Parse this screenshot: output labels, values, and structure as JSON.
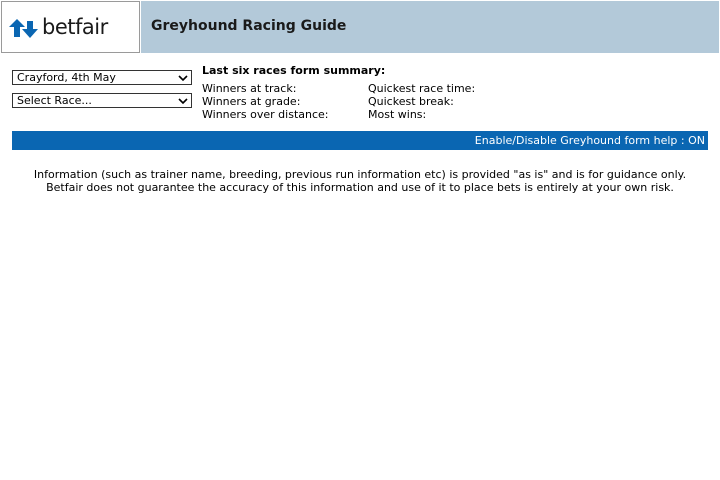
{
  "header": {
    "logo_text": "betfair",
    "title": "Greyhound Racing Guide"
  },
  "selectors": {
    "meeting": "Crayford, 4th May",
    "race": "Select Race..."
  },
  "summary": {
    "title": "Last six races form summary:",
    "left_stats": [
      "Winners at track:",
      "Winners at grade:",
      "Winners over distance:"
    ],
    "right_stats": [
      "Quickest race time:",
      "Quickest break:",
      "Most wins:"
    ]
  },
  "help_toggle": {
    "label": "Enable/Disable Greyhound form help : ON"
  },
  "disclaimer": {
    "line1": "Information (such as trainer name, breeding, previous run information etc) is provided \"as is\" and is for guidance only.",
    "line2": "Betfair does not guarantee the accuracy of this information and use of it to place bets is entirely at your own risk."
  },
  "colors": {
    "title_bar": "#b3c9d9",
    "help_bar": "#0a66b2",
    "logo_arrow": "#0a66b2"
  }
}
